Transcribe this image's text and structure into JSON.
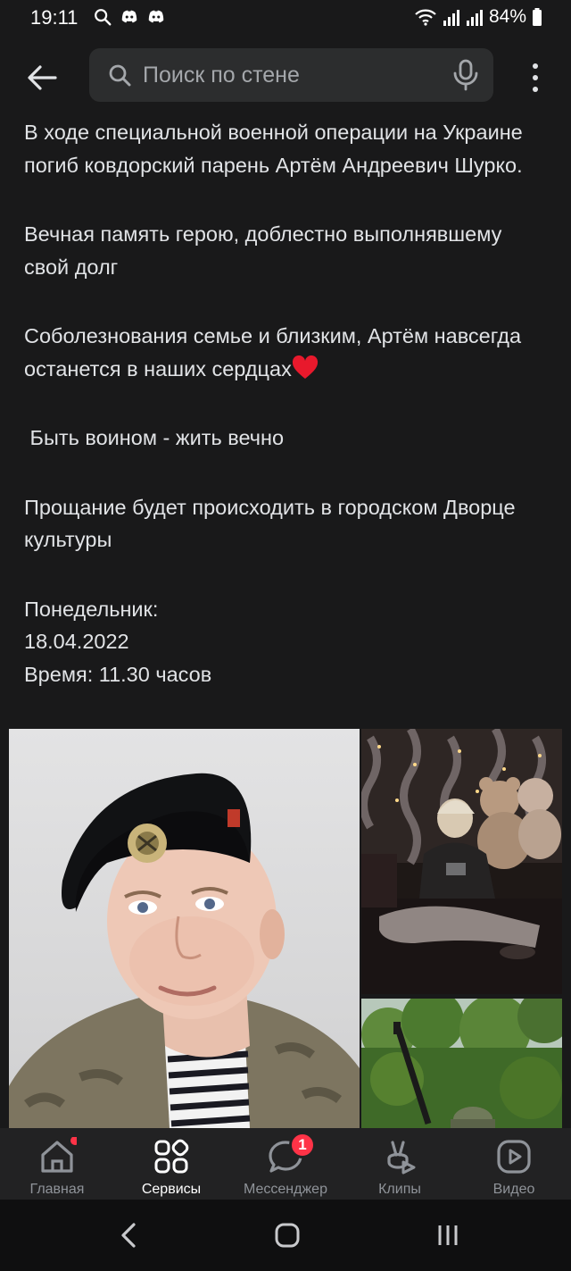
{
  "status_bar": {
    "time": "19:11",
    "battery": "84%",
    "left_icons": [
      "search-icon",
      "discord-icon",
      "discord-icon"
    ],
    "right_icons": [
      "wifi-icon",
      "signal-icon",
      "signal-icon",
      "battery-icon"
    ]
  },
  "header": {
    "search_placeholder": "Поиск по стене",
    "back_icon": "arrow-left-icon",
    "mic_icon": "microphone-icon",
    "more_icon": "more-vertical-icon"
  },
  "post": {
    "paragraphs": [
      "В ходе специальной военной операции на Украине погиб ковдорский парень Артём Андреевич Шурко.",
      "Вечная память герою, доблестно выполнявшему свой долг",
      "Соболезнования семье и близким, Артём навсегда останется в наших сердцах",
      " Быть воином - жить вечно",
      "Прощание будет происходить в городском Дворце культуры",
      "Понедельник:\n18.04.2022\nВремя: 11.30 часов"
    ]
  },
  "bottom_nav": {
    "items": [
      {
        "label": "Главная",
        "icon": "home-icon",
        "active": false
      },
      {
        "label": "Сервисы",
        "icon": "services-grid-icon",
        "active": true
      },
      {
        "label": "Мессенджер",
        "icon": "chat-bubble-icon",
        "active": false,
        "badge": "1"
      },
      {
        "label": "Клипы",
        "icon": "clips-icon",
        "active": false
      },
      {
        "label": "Видео",
        "icon": "video-play-icon",
        "active": false
      }
    ]
  },
  "colors": {
    "background": "#19191a",
    "text": "#e1e3e6",
    "badge": "#ff3347",
    "nav_bg": "#222223",
    "search_bg": "#2c2d2e"
  }
}
